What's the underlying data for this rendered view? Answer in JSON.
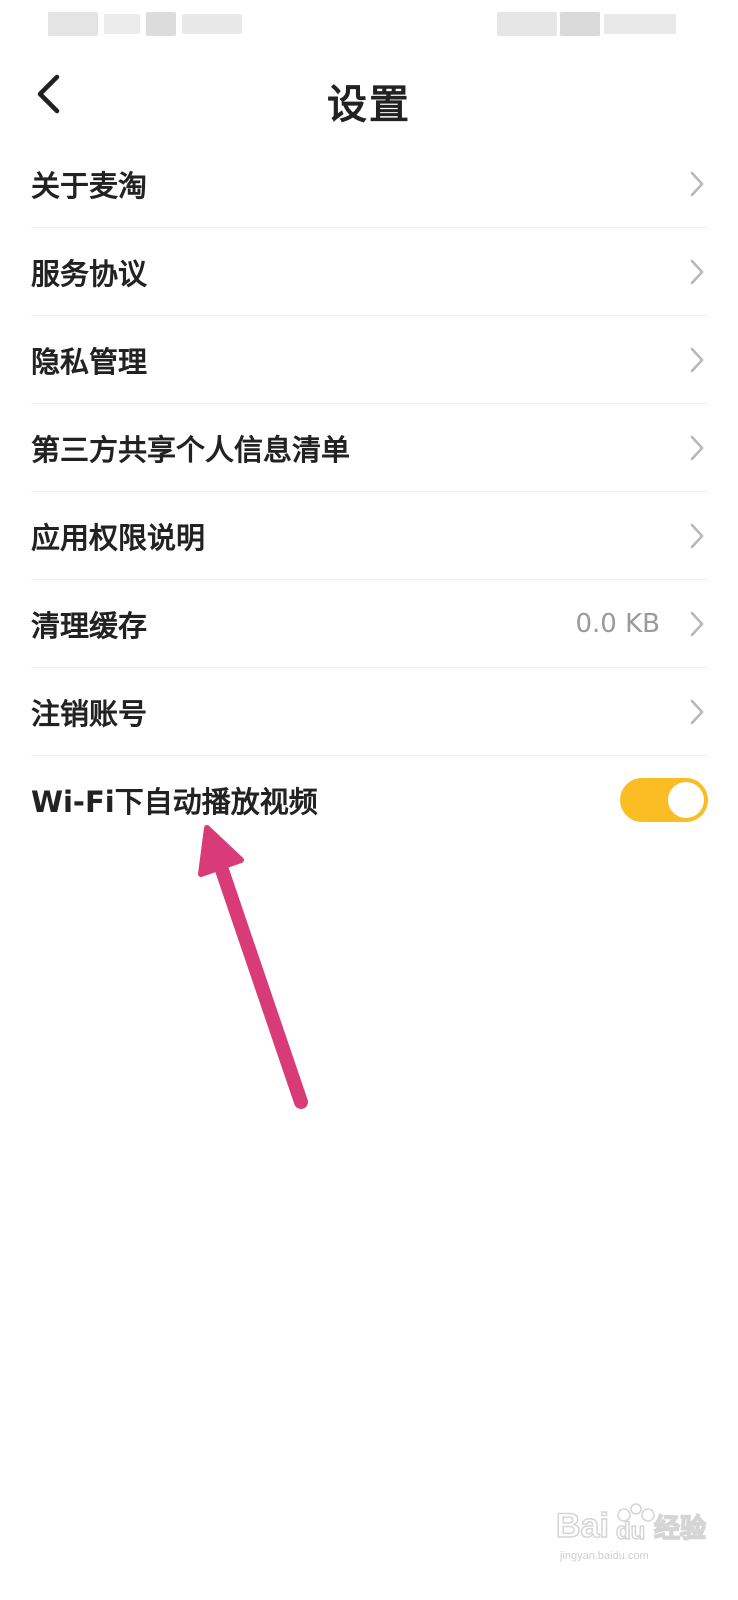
{
  "header": {
    "title": "设置"
  },
  "settings": {
    "items": [
      {
        "label": "关于麦淘",
        "value": ""
      },
      {
        "label": "服务协议",
        "value": ""
      },
      {
        "label": "隐私管理",
        "value": ""
      },
      {
        "label": "第三方共享个人信息清单",
        "value": ""
      },
      {
        "label": "应用权限说明",
        "value": ""
      },
      {
        "label": "清理缓存",
        "value": "0.0 KB"
      },
      {
        "label": "注销账号",
        "value": ""
      }
    ],
    "toggle": {
      "label": "Wi-Fi下自动播放视频",
      "enabled": true
    }
  },
  "colors": {
    "toggle_on": "#fbbd24",
    "annotation_arrow": "#d93a78"
  },
  "watermark": {
    "brand": "Baidu经验",
    "url": "jingyan.baidu.com"
  }
}
